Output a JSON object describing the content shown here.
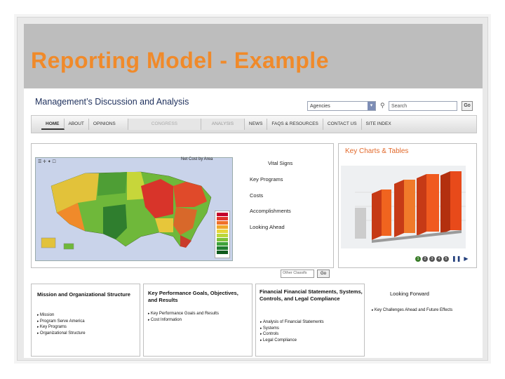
{
  "slide": {
    "title": "Reporting Model - Example"
  },
  "site": {
    "heading": "Management’s Discussion and Analysis",
    "agencies_select": "Agencies",
    "search_placeholder": "Search",
    "go_label": "Go",
    "nav": [
      "HOME",
      "ABOUT",
      "OPINIONS",
      "CONGRESS",
      "ANALYSIS",
      "NEWS",
      "FAQS & RESOURCES",
      "CONTACT US",
      "SITE INDEX"
    ]
  },
  "main_panel": {
    "map_label": "Net Cost by Area",
    "heading": "Vital Signs",
    "links": [
      "Key Programs",
      "Costs",
      "Accomplishments",
      "Looking Ahead"
    ],
    "map_search_placeholder": "Other Classifs",
    "map_go_label": "Go"
  },
  "charts_panel": {
    "title": "Key Charts & Tables",
    "slide_numbers": [
      "1",
      "2",
      "3",
      "4",
      "5"
    ]
  },
  "bottom": {
    "mission": {
      "title": "Mission and Organizational Structure",
      "items": [
        "Mission",
        "Program Serve America",
        "Key Programs",
        "Organizational Structure"
      ]
    },
    "goals": {
      "title": "Key Performance Goals, Objectives, and Results",
      "items": [
        "Key Performance Goals and Results",
        "Cost Information"
      ]
    },
    "financial": {
      "title": "Financial Financial Statements, Systems, Controls, and Legal Compliance",
      "items": [
        "Analysis of Financial Statements",
        "Systems",
        "Controls",
        "Legal Compliance"
      ]
    },
    "forward": {
      "title": "Looking Forward",
      "items": [
        "Key Challenges Ahead and Future Effects"
      ]
    }
  },
  "colors": {
    "title_orange": "#f08a2a",
    "header_gray": "#bdbdbd",
    "chart_orange": "#e8501f"
  }
}
